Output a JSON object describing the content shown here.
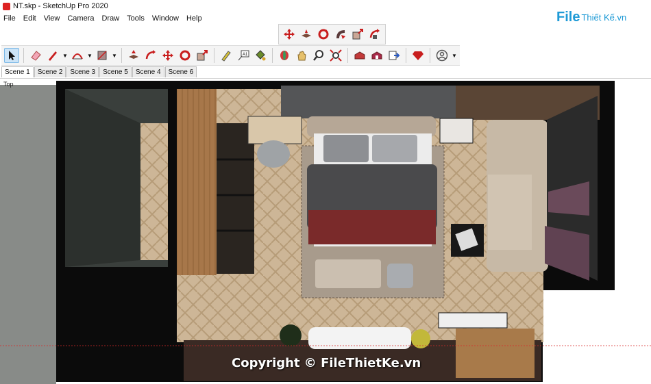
{
  "window": {
    "title": "NT.skp - SketchUp Pro 2020"
  },
  "menu": [
    "File",
    "Edit",
    "View",
    "Camera",
    "Draw",
    "Tools",
    "Window",
    "Help"
  ],
  "toolbar_top": [
    "orbit-icon",
    "pan-icon",
    "rotate-icon",
    "follow-me-icon",
    "scale-icon",
    "rotate-arc-icon"
  ],
  "toolbar_main": [
    "select-icon",
    "eraser-icon",
    "pencil-icon",
    "arc-icon",
    "shape-icon",
    "push-pull-icon",
    "rotate-arc-icon",
    "move-icon",
    "rotate-icon",
    "scale-icon",
    "tape-measure-icon",
    "text-icon",
    "paint-bucket-icon",
    "orbit-icon",
    "pan-hand-icon",
    "zoom-icon",
    "zoom-extents-icon",
    "warehouse-icon",
    "extension-warehouse-icon",
    "send-to-layout-icon",
    "ruby-icon",
    "account-icon"
  ],
  "scenes": [
    "Scene 1",
    "Scene 2",
    "Scene 3",
    "Scene 5",
    "Scene 4",
    "Scene 6"
  ],
  "viewport": {
    "view_label": "Top"
  },
  "watermark": {
    "logo_main": "File",
    "logo_sub": "Thiết Kế.vn",
    "copyright": "Copyright © FileThietKe.vn"
  },
  "colors": {
    "accent_red": "#d62a2a",
    "wood": "#c9b08a",
    "dark_wall": "#1a1a1a",
    "wall_gray": "#5a5f5a"
  }
}
